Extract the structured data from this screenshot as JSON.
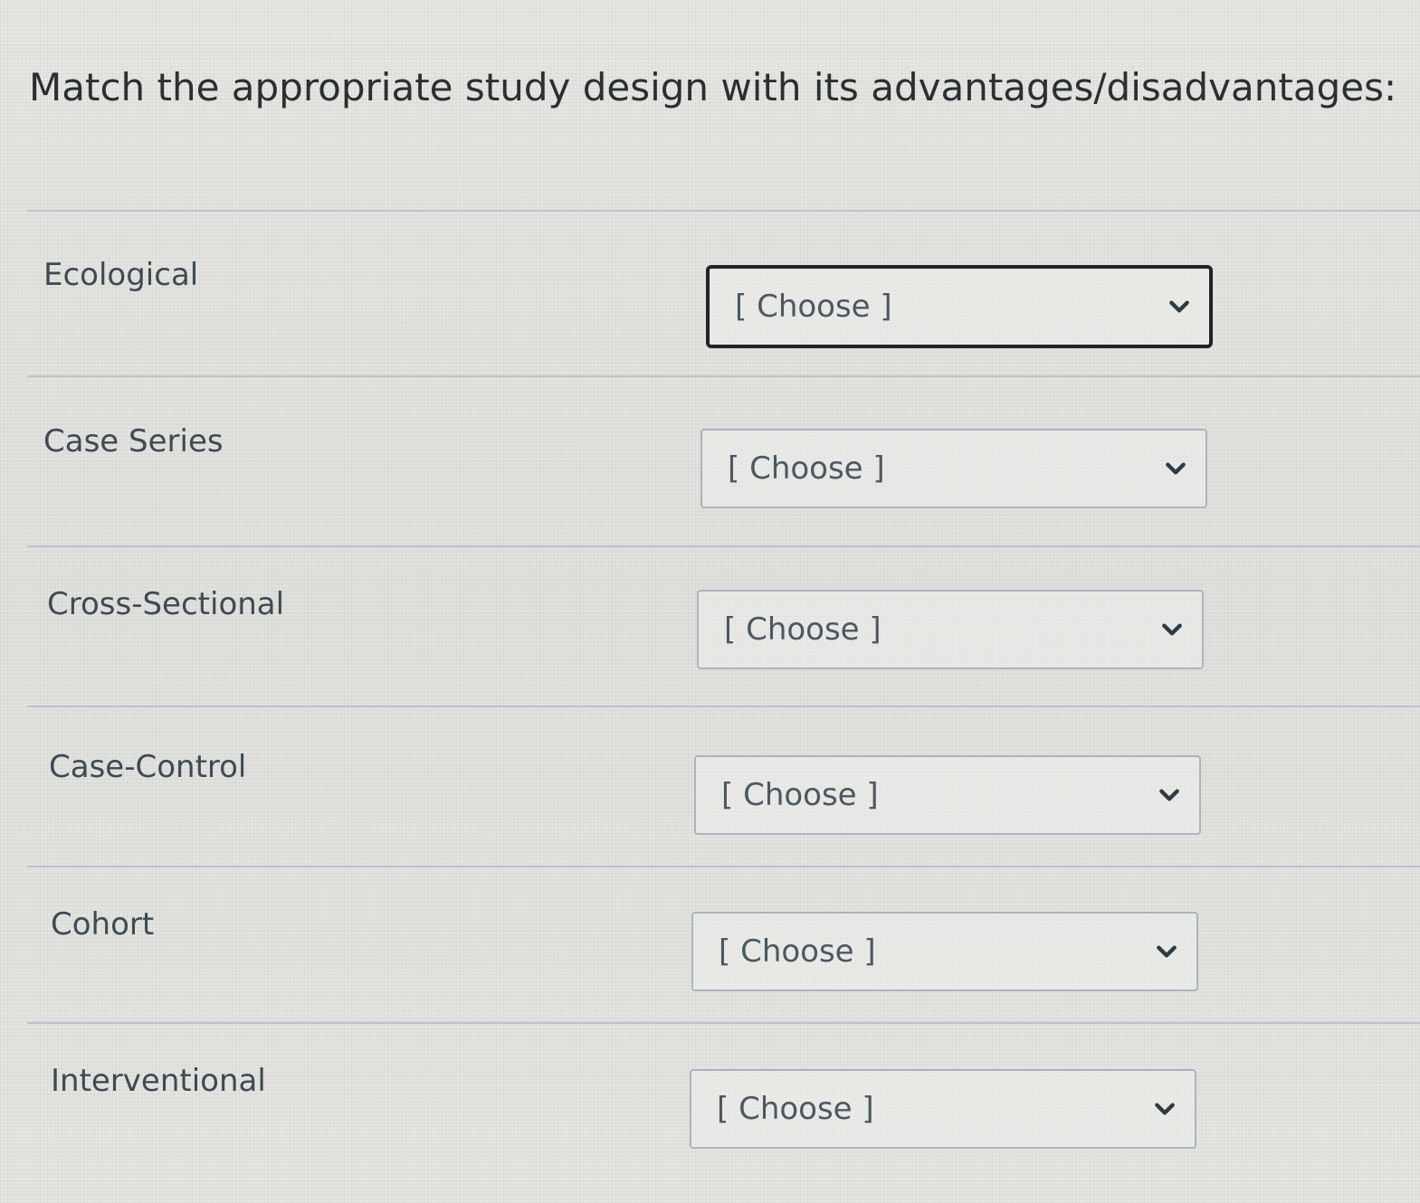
{
  "question": {
    "prompt": "Match the appropriate study design with its advantages/disadvantages:"
  },
  "rows": [
    {
      "label": "Ecological",
      "selected": "[ Choose ]",
      "focused": true
    },
    {
      "label": "Case Series",
      "selected": "[ Choose ]",
      "focused": false
    },
    {
      "label": "Cross-Sectional",
      "selected": "[ Choose ]",
      "focused": false
    },
    {
      "label": "Case-Control",
      "selected": "[ Choose ]",
      "focused": false
    },
    {
      "label": "Cohort",
      "selected": "[ Choose ]",
      "focused": false
    },
    {
      "label": "Interventional",
      "selected": "[ Choose ]",
      "focused": false
    }
  ],
  "icons": {
    "dropdown": "chevron-down-icon"
  },
  "colors": {
    "background": "#e3e3df",
    "text": "#2a2f33",
    "border": "#aab4bf",
    "focus_border": "#1f2428"
  }
}
